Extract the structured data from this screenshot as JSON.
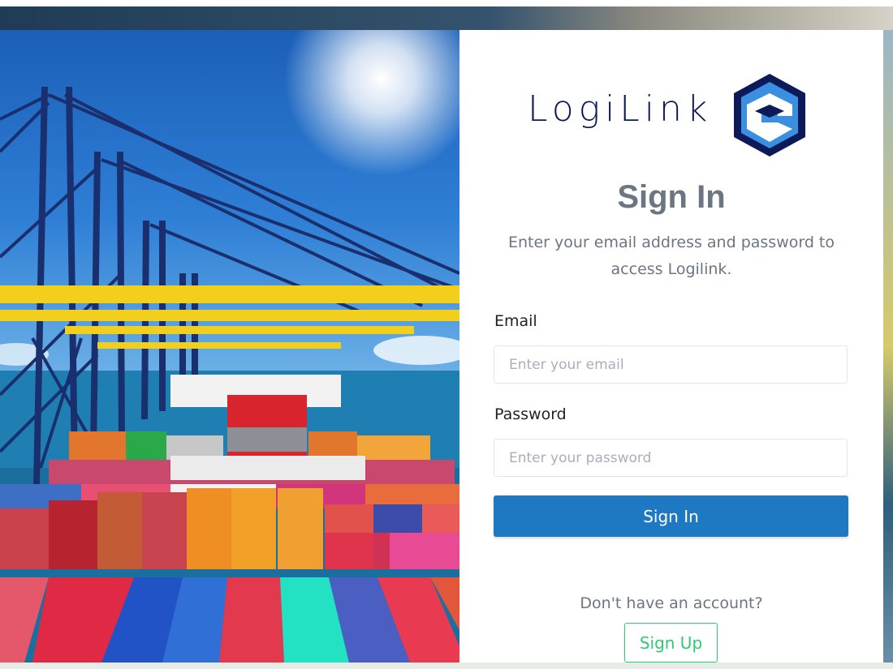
{
  "brand": {
    "name": "LogiLink",
    "logo_icon": "logilink-hexagon-logo-icon",
    "colors": {
      "navy": "#0d1a5a",
      "blue": "#3a8fe0"
    }
  },
  "hero": {
    "image": "container-port-cranes-photo",
    "alt": "Container ship at port with cranes"
  },
  "signin": {
    "title": "Sign In",
    "subtitle": "Enter your email address and password to access Logilink.",
    "email_label": "Email",
    "email_placeholder": "Enter your email",
    "email_value": "",
    "password_label": "Password",
    "password_placeholder": "Enter your password",
    "password_value": "",
    "submit_label": "Sign In",
    "submit_color": "#1e78c2"
  },
  "signup": {
    "prompt": "Don't have an account?",
    "button_label": "Sign Up",
    "button_color": "#2ecc71"
  }
}
